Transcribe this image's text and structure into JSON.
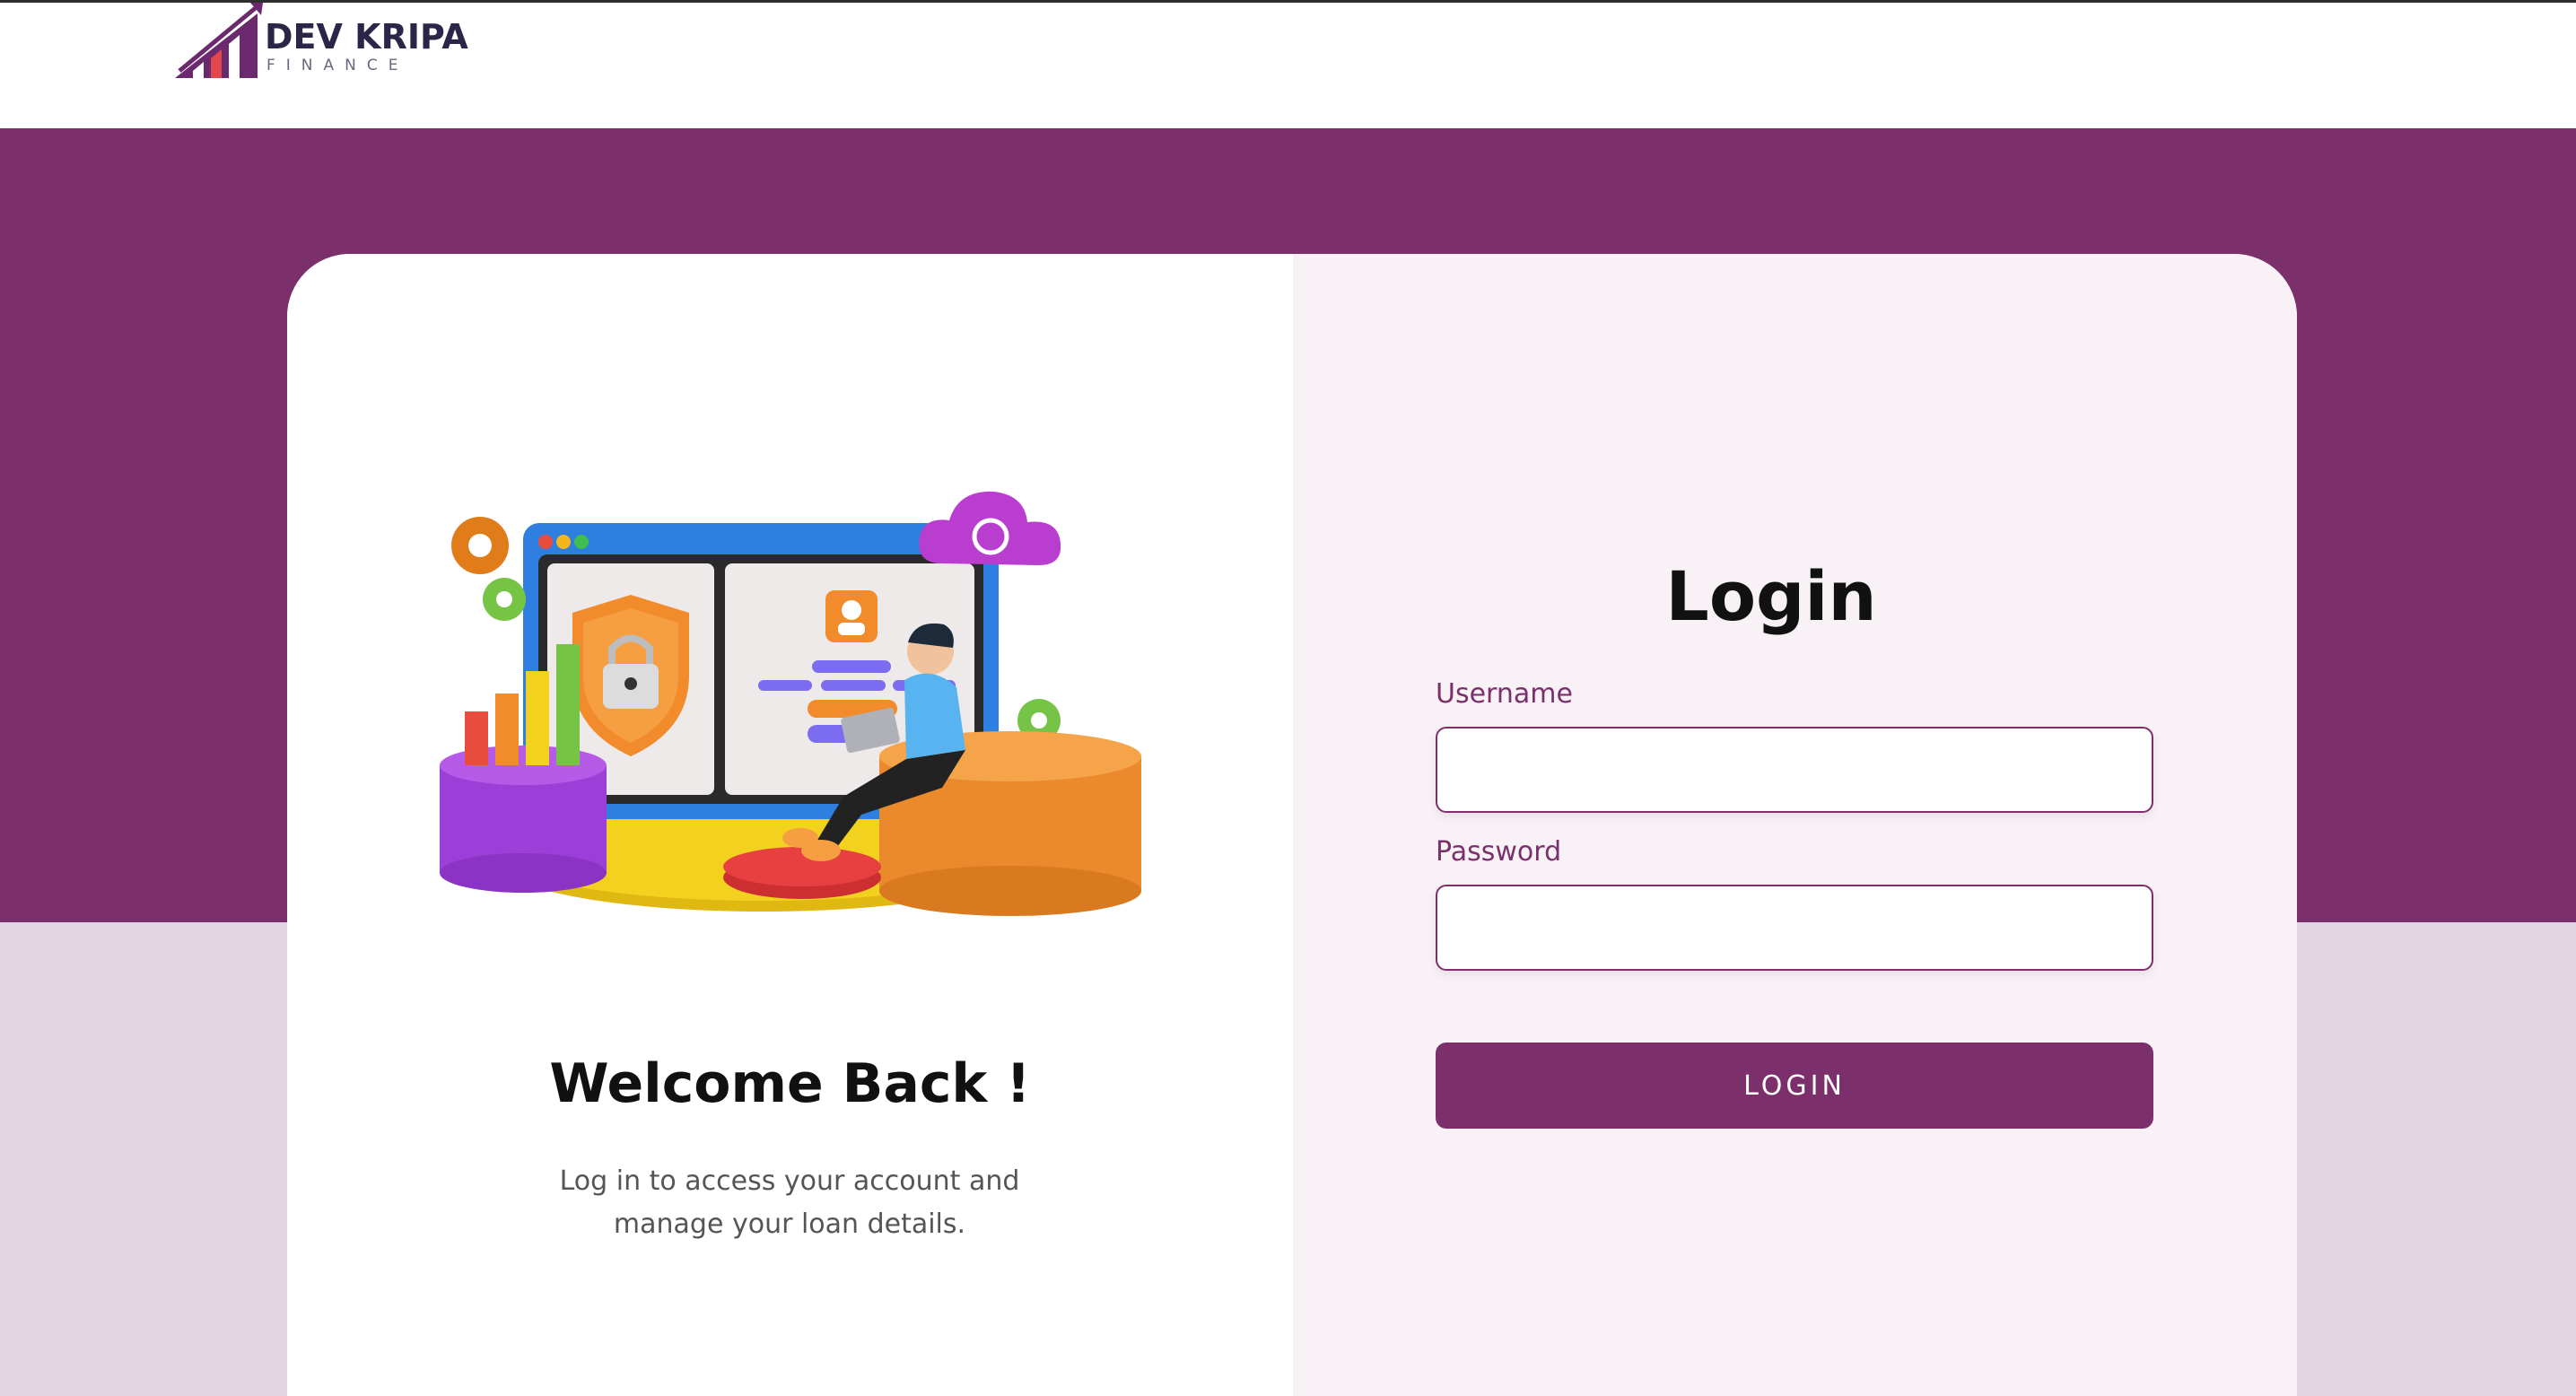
{
  "header": {
    "logo_name": "DEV KRIPA",
    "logo_subtitle": "FINANCE"
  },
  "welcome": {
    "title": "Welcome Back !",
    "message": "Log in to access your account and manage your loan details."
  },
  "login": {
    "title": "Login",
    "username_label": "Username",
    "username_value": "",
    "password_label": "Password",
    "password_value": "",
    "button_label": "LOGIN"
  },
  "colors": {
    "brand": "#7b306c",
    "background": "#e3d5e2",
    "right_panel": "#f8f2f7"
  }
}
